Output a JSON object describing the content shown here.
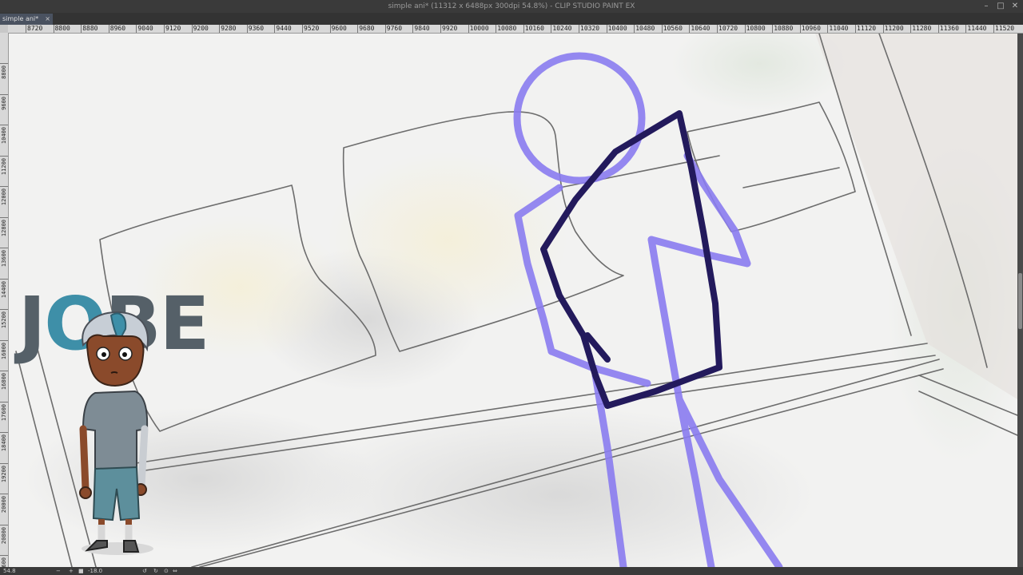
{
  "window": {
    "title": "simple ani* (11312 x 6488px 300dpi 54.8%)  - CLIP STUDIO PAINT EX",
    "minimize": "–",
    "maximize": "□",
    "close": "✕"
  },
  "tabs": [
    {
      "label": "simple ani*",
      "close": "×"
    }
  ],
  "ruler_h": [
    "8720",
    "8800",
    "8880",
    "8960",
    "9040",
    "9120",
    "9200",
    "9280",
    "9360",
    "9440",
    "9520",
    "9600",
    "9680",
    "9760",
    "9840",
    "9920",
    "10000",
    "10080",
    "10160",
    "10240",
    "10320",
    "10400",
    "10480",
    "10560",
    "10640",
    "10720",
    "10800",
    "10880",
    "10960",
    "11040",
    "11120",
    "11200",
    "11280",
    "11360",
    "11440",
    "11520"
  ],
  "ruler_v": [
    "8800",
    "9600",
    "10400",
    "11200",
    "12000",
    "12800",
    "13600",
    "14400",
    "15200",
    "16000",
    "16800",
    "17600",
    "18400",
    "19200",
    "20000",
    "20800",
    "21600"
  ],
  "logo": {
    "first": "J",
    "accent": "O",
    "rest": "BE"
  },
  "status": {
    "zoom": "54.8",
    "angle": "-18.0"
  },
  "colors": {
    "sketch_light": "#8a7cf0",
    "sketch_dark": "#231a5c",
    "logo_gray": "#556068",
    "logo_accent": "#3e8fa8"
  }
}
